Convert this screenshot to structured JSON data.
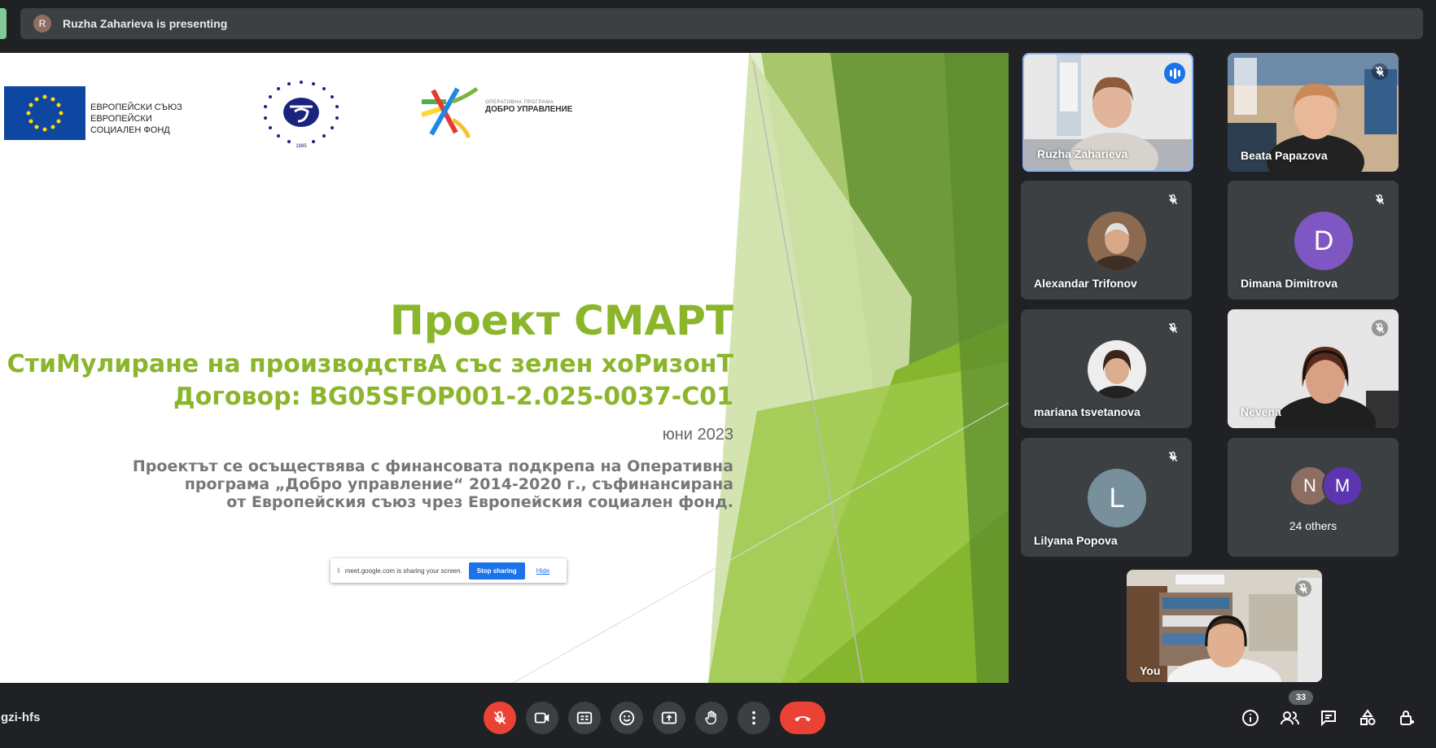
{
  "presenting": {
    "avatar_letter": "R",
    "text": "Ruzha Zaharieva is presenting"
  },
  "slide": {
    "eu_logo_text": [
      "ЕВРОПЕЙСКИ СЪЮЗ",
      "ЕВРОПЕЙСКИ",
      "СОЦИАЛЕН ФОНД"
    ],
    "university_year": "1895",
    "op_logo_small": "ОПЕРАТИВНА ПРОГРАМА",
    "op_logo_main": "ДОБРО УПРАВЛЕНИЕ",
    "title": "Проект СМАРТ",
    "subtitle": "СтиМулиране на производствА със зелен хоРизонТ",
    "contract": "Договор: BG05SFOP001-2.025-0037-C01",
    "date": "юни 2023",
    "description": [
      "Проектът се осъществява с финансовата подкрепа на Оперативна",
      "програма „Добро управление“ 2014-2020 г., съфинансирана",
      "от Европейския съюз чрез Европейския социален фонд."
    ]
  },
  "share_popup": {
    "text": "meet.google.com is sharing your screen.",
    "stop_label": "Stop sharing",
    "hide_label": "Hide"
  },
  "slide_menu": "...",
  "participants": {
    "ruzha": "Ruzha Zaharieva",
    "beata": "Beata Papazova",
    "alexandar": "Alexandar Trifonov",
    "dimana": "Dimana Dimitrova",
    "dimana_letter": "D",
    "mariana": "mariana tsvetanova",
    "nevena": "Nevena",
    "lilyana": "Lilyana Popova",
    "lilyana_letter": "L",
    "others_letters": [
      "N",
      "M"
    ],
    "others_label": "24 others",
    "you": "You"
  },
  "colors": {
    "dimana": "#7e57c2",
    "lilyana": "#78909c",
    "other_n": "#8d6e63",
    "other_m": "#5e35b1",
    "accent": "#8bb52b",
    "danger": "#ea4335"
  },
  "meeting_code": "gzi-hfs",
  "people_count": "33"
}
